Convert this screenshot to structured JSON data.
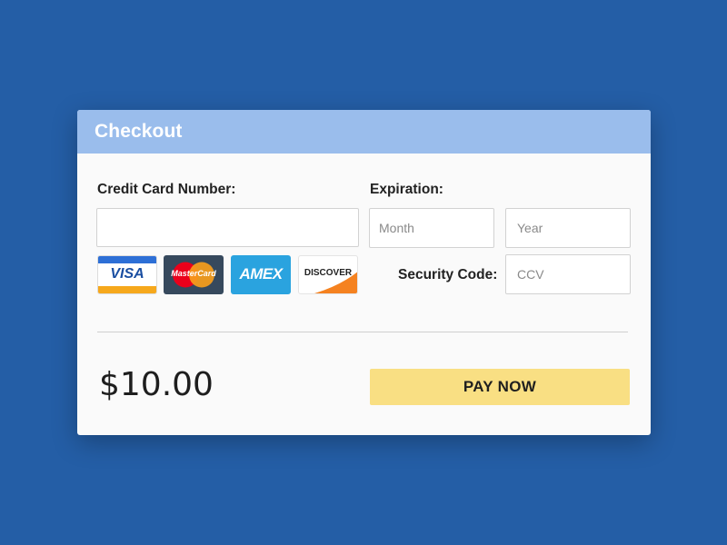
{
  "checkout": {
    "title": "Checkout"
  },
  "card_number": {
    "label": "Credit Card Number:",
    "value": "",
    "placeholder": ""
  },
  "card_logos": [
    {
      "brand": "VISA",
      "icon": "visa-logo-icon",
      "color": "#1a1f71"
    },
    {
      "brand": "MasterCard",
      "icon": "mastercard-logo-icon",
      "color": "#36495d"
    },
    {
      "brand": "AMEX",
      "icon": "amex-logo-icon",
      "color": "#2aa3df"
    },
    {
      "brand": "DISCOVER",
      "icon": "discover-logo-icon",
      "color": "#f58220"
    }
  ],
  "expiration": {
    "label": "Expiration:",
    "month_placeholder": "Month",
    "year_placeholder": "Year"
  },
  "security": {
    "label": "Security Code:",
    "placeholder": "CCV"
  },
  "total": {
    "amount": "$10.00"
  },
  "pay_button": {
    "label": "PAY NOW"
  },
  "colors": {
    "background": "#245ea6",
    "header": "#9abdec",
    "pay_button": "#f9df83"
  }
}
